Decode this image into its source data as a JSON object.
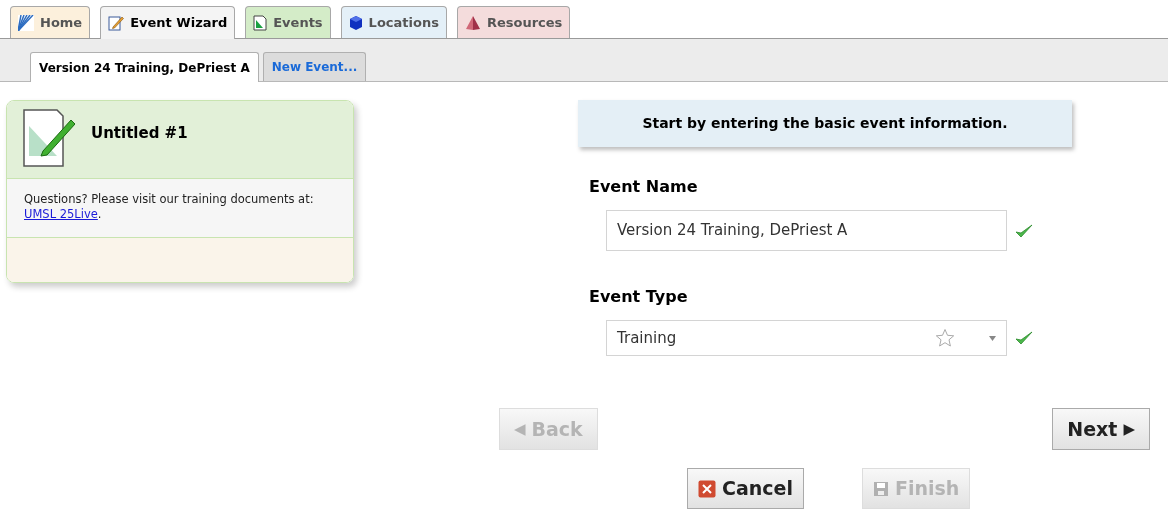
{
  "tabs": [
    {
      "label": "Home",
      "kind": "home",
      "color": "#fcf0dc",
      "selected": false
    },
    {
      "label": "Event Wizard",
      "kind": "wizard",
      "color": "#f4f4f4",
      "selected": true
    },
    {
      "label": "Events",
      "kind": "events",
      "color": "#d4ecc8",
      "selected": false
    },
    {
      "label": "Locations",
      "kind": "locations",
      "color": "#e4f0f8",
      "selected": false
    },
    {
      "label": "Resources",
      "kind": "resources",
      "color": "#f4dcdc",
      "selected": false
    }
  ],
  "subtabs": [
    {
      "label": "Version 24 Training, DePriest A",
      "selected": true
    },
    {
      "label": "New Event...",
      "selected": false
    }
  ],
  "card": {
    "title": "Untitled #1",
    "help": "Questions? Please visit our training documents at: ",
    "link": "UMSL 25Live",
    "after": "."
  },
  "banner": "Start by entering the basic event information.",
  "fields": [
    {
      "label": "Event Name",
      "kind": "text",
      "value": "Version 24 Training, DePriest A",
      "valid": true
    },
    {
      "label": "Event Type",
      "kind": "select",
      "value": "Training",
      "favorite": false,
      "valid": true
    }
  ],
  "nav": [
    {
      "label": "Back",
      "arrow": "◀",
      "kind": "back",
      "disabled": true
    },
    {
      "label": "Next",
      "arrow": "▶",
      "kind": "next",
      "disabled": false
    }
  ],
  "actions": [
    {
      "label": "Cancel",
      "kind": "cancel",
      "disabled": false
    },
    {
      "label": "Finish",
      "kind": "save",
      "disabled": true
    }
  ]
}
